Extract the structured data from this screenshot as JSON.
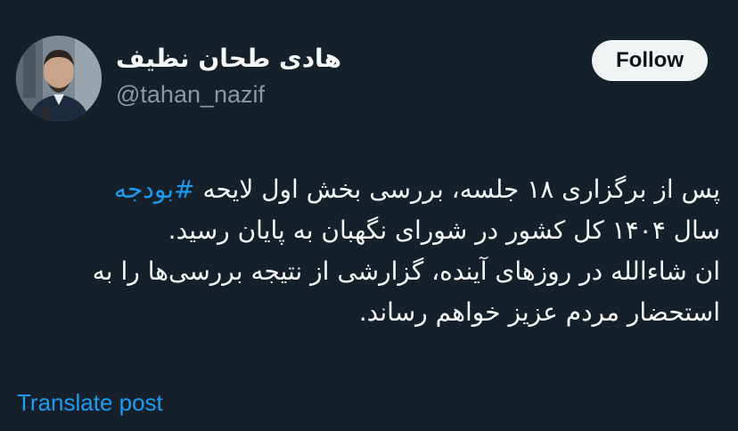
{
  "author": {
    "display_name": "هادی طحان نظیف",
    "handle": "@tahan_nazif"
  },
  "follow_button": {
    "label": "Follow"
  },
  "tweet": {
    "line1_text": "پس از برگزاری ۱۸ جلسه، بررسی بخش اول لایحه ",
    "hashtag": "#بودجه",
    "line2": "سال ۱۴۰۴ کل کشور در شورای نگهبان به پایان رسید.",
    "line3": "ان شاءالله در روزهای آینده، گزارشی از نتیجه بررسی‌ها را به",
    "line4": "استحضار مردم عزیز خواهم رساند."
  },
  "translate": {
    "label": "Translate post"
  },
  "colors": {
    "background": "#15202b",
    "primary_text": "#f7f9f9",
    "secondary_text": "#8b98a5",
    "link": "#1d9bf0",
    "follow_bg": "#eff3f4"
  },
  "icons": {
    "avatar": "user-avatar-photo"
  }
}
